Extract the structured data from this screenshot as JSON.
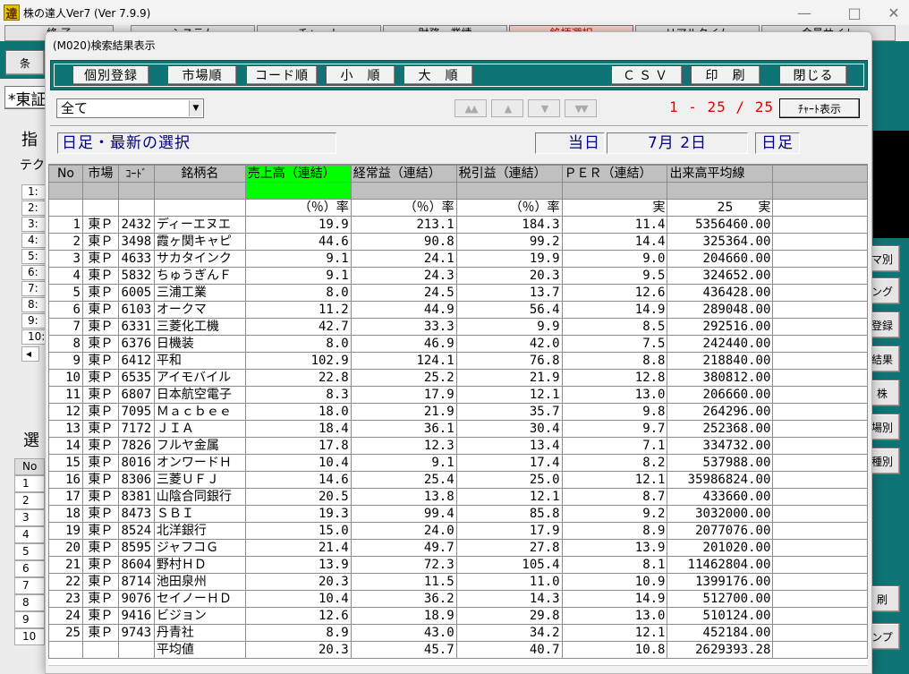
{
  "main_window": {
    "icon_glyph": "達",
    "title": "株の達人Ver7 (Ver 7.9.9)",
    "menu": [
      {
        "label": "終 了"
      },
      {
        "label": "システム"
      },
      {
        "label": "チャート"
      },
      {
        "label": "財務・業績"
      },
      {
        "label": "銘柄選択",
        "active": true
      },
      {
        "label": "リアルタイム"
      },
      {
        "label": "会員サイト"
      }
    ],
    "left_panel": {
      "cond_button": "条",
      "market_field": "*東証",
      "indicator_heading": "指",
      "technical_label": "テク",
      "index_rows": [
        "1:",
        "2:",
        "3:",
        "4:",
        "5:",
        "6:",
        "7:",
        "8:",
        "9:",
        "10:"
      ],
      "scroll_left": "◂",
      "select_heading": "選",
      "no_header": "No",
      "no_rows": [
        "1",
        "2",
        "3",
        "4",
        "5",
        "6",
        "7",
        "8",
        "9",
        "10"
      ]
    },
    "right_buttons": [
      "マ別",
      "ング",
      "登録",
      "結果",
      "株",
      "場別",
      "種別",
      "刷",
      "ンプ"
    ]
  },
  "dialog": {
    "title": "(M020)検索結果表示",
    "toolbar": {
      "individual_register": "個別登録",
      "market_order": "市場順",
      "code_order": "コード順",
      "ascending": "小　順",
      "descending": "大　順",
      "csv": "ＣＳＶ",
      "print": "印　刷",
      "close": "閉じる"
    },
    "filter": {
      "selected": "全て",
      "arrow": "▼"
    },
    "nav": {
      "first": "▲▲",
      "prev": "▲",
      "next": "▼",
      "last": "▼▼"
    },
    "page_indicator": "1 - 25 / 25",
    "chart_button": "ﾁｬｰﾄ表示",
    "info_bar": {
      "selection": "日足・最新の選択",
      "today_label": "当日",
      "date": "7月 2日",
      "period": "日足"
    },
    "grid": {
      "columns": [
        "No",
        "市場",
        "ｺｰﾄﾞ",
        "銘柄名",
        "売上高（連結）",
        "経常益（連結）",
        "税引益（連結）",
        "ＰＥＲ（連結）",
        "出来高平均線"
      ],
      "units": [
        "",
        "",
        "",
        "",
        "（％）率",
        "（％）率",
        "（％）率",
        "実",
        "25　　実"
      ],
      "rows": [
        {
          "no": "1",
          "market": "東Ｐ",
          "code": "2432",
          "name": "ディーエヌエ",
          "sales": "19.9",
          "ordinary": "213.1",
          "net": "184.3",
          "per": "11.4",
          "volume": "5356460.00"
        },
        {
          "no": "2",
          "market": "東Ｐ",
          "code": "3498",
          "name": "霞ヶ関キャピ",
          "sales": "44.6",
          "ordinary": "90.8",
          "net": "99.2",
          "per": "14.4",
          "volume": "325364.00"
        },
        {
          "no": "3",
          "market": "東Ｐ",
          "code": "4633",
          "name": "サカタインク",
          "sales": "9.1",
          "ordinary": "24.1",
          "net": "19.9",
          "per": "9.0",
          "volume": "204660.00"
        },
        {
          "no": "4",
          "market": "東Ｐ",
          "code": "5832",
          "name": "ちゅうぎんＦ",
          "sales": "9.1",
          "ordinary": "24.3",
          "net": "20.3",
          "per": "9.5",
          "volume": "324652.00"
        },
        {
          "no": "5",
          "market": "東Ｐ",
          "code": "6005",
          "name": "三浦工業",
          "sales": "8.0",
          "ordinary": "24.5",
          "net": "13.7",
          "per": "12.6",
          "volume": "436428.00"
        },
        {
          "no": "6",
          "market": "東Ｐ",
          "code": "6103",
          "name": "オークマ",
          "sales": "11.2",
          "ordinary": "44.9",
          "net": "56.4",
          "per": "14.9",
          "volume": "289048.00"
        },
        {
          "no": "7",
          "market": "東Ｐ",
          "code": "6331",
          "name": "三菱化工機",
          "sales": "42.7",
          "ordinary": "33.3",
          "net": "9.9",
          "per": "8.5",
          "volume": "292516.00"
        },
        {
          "no": "8",
          "market": "東Ｐ",
          "code": "6376",
          "name": "日機装",
          "sales": "8.0",
          "ordinary": "46.9",
          "net": "42.0",
          "per": "7.5",
          "volume": "242440.00"
        },
        {
          "no": "9",
          "market": "東Ｐ",
          "code": "6412",
          "name": "平和",
          "sales": "102.9",
          "ordinary": "124.1",
          "net": "76.8",
          "per": "8.8",
          "volume": "218840.00"
        },
        {
          "no": "10",
          "market": "東Ｐ",
          "code": "6535",
          "name": "アイモバイル",
          "sales": "22.8",
          "ordinary": "25.2",
          "net": "21.9",
          "per": "12.8",
          "volume": "380812.00"
        },
        {
          "no": "11",
          "market": "東Ｐ",
          "code": "6807",
          "name": "日本航空電子",
          "sales": "8.3",
          "ordinary": "17.9",
          "net": "12.1",
          "per": "13.0",
          "volume": "206660.00"
        },
        {
          "no": "12",
          "market": "東Ｐ",
          "code": "7095",
          "name": "Ｍａｃｂｅｅ",
          "sales": "18.0",
          "ordinary": "21.9",
          "net": "35.7",
          "per": "9.8",
          "volume": "264296.00"
        },
        {
          "no": "13",
          "market": "東Ｐ",
          "code": "7172",
          "name": "ＪＩＡ",
          "sales": "18.4",
          "ordinary": "36.1",
          "net": "30.4",
          "per": "9.7",
          "volume": "252368.00"
        },
        {
          "no": "14",
          "market": "東Ｐ",
          "code": "7826",
          "name": "フルヤ金属",
          "sales": "17.8",
          "ordinary": "12.3",
          "net": "13.4",
          "per": "7.1",
          "volume": "334732.00"
        },
        {
          "no": "15",
          "market": "東Ｐ",
          "code": "8016",
          "name": "オンワードＨ",
          "sales": "10.4",
          "ordinary": "9.1",
          "net": "17.4",
          "per": "8.2",
          "volume": "537988.00"
        },
        {
          "no": "16",
          "market": "東Ｐ",
          "code": "8306",
          "name": "三菱ＵＦＪ",
          "sales": "14.6",
          "ordinary": "25.4",
          "net": "25.0",
          "per": "12.1",
          "volume": "35986824.00"
        },
        {
          "no": "17",
          "market": "東Ｐ",
          "code": "8381",
          "name": "山陰合同銀行",
          "sales": "20.5",
          "ordinary": "13.8",
          "net": "12.1",
          "per": "8.7",
          "volume": "433660.00"
        },
        {
          "no": "18",
          "market": "東Ｐ",
          "code": "8473",
          "name": "ＳＢＩ",
          "sales": "19.3",
          "ordinary": "99.4",
          "net": "85.8",
          "per": "9.2",
          "volume": "3032000.00"
        },
        {
          "no": "19",
          "market": "東Ｐ",
          "code": "8524",
          "name": "北洋銀行",
          "sales": "15.0",
          "ordinary": "24.0",
          "net": "17.9",
          "per": "8.9",
          "volume": "2077076.00"
        },
        {
          "no": "20",
          "market": "東Ｐ",
          "code": "8595",
          "name": "ジャフコＧ",
          "sales": "21.4",
          "ordinary": "49.7",
          "net": "27.8",
          "per": "13.9",
          "volume": "201020.00"
        },
        {
          "no": "21",
          "market": "東Ｐ",
          "code": "8604",
          "name": "野村ＨＤ",
          "sales": "13.9",
          "ordinary": "72.3",
          "net": "105.4",
          "per": "8.1",
          "volume": "11462804.00"
        },
        {
          "no": "22",
          "market": "東Ｐ",
          "code": "8714",
          "name": "池田泉州",
          "sales": "20.3",
          "ordinary": "11.5",
          "net": "11.0",
          "per": "10.9",
          "volume": "1399176.00"
        },
        {
          "no": "23",
          "market": "東Ｐ",
          "code": "9076",
          "name": "セイノーＨＤ",
          "sales": "10.4",
          "ordinary": "36.2",
          "net": "14.3",
          "per": "14.9",
          "volume": "512700.00"
        },
        {
          "no": "24",
          "market": "東Ｐ",
          "code": "9416",
          "name": "ビジョン",
          "sales": "12.6",
          "ordinary": "18.9",
          "net": "29.8",
          "per": "13.0",
          "volume": "510124.00"
        },
        {
          "no": "25",
          "market": "東Ｐ",
          "code": "9743",
          "name": "丹青社",
          "sales": "8.9",
          "ordinary": "43.0",
          "net": "34.2",
          "per": "12.1",
          "volume": "452184.00"
        }
      ],
      "average": {
        "label": "平均値",
        "sales": "20.3",
        "ordinary": "45.7",
        "net": "40.7",
        "per": "10.8",
        "volume": "2629393.28"
      }
    }
  },
  "colors": {
    "teal": "#0f7474",
    "highlight_green": "#00ff00",
    "page_red": "#e00000",
    "info_navy": "#000080"
  }
}
